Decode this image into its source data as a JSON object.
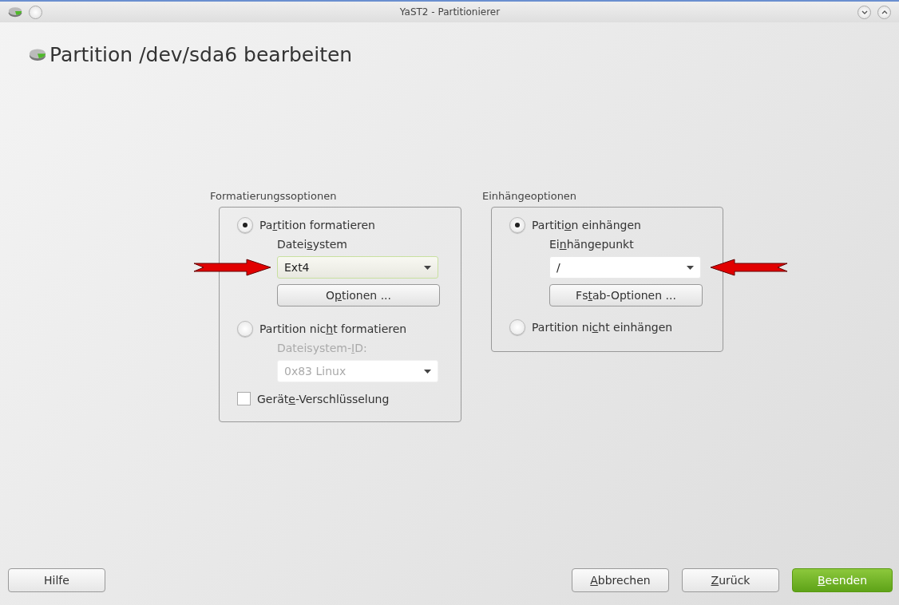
{
  "window": {
    "title": "YaST2 - Partitionierer"
  },
  "heading": "Partition /dev/sda6 bearbeiten",
  "format_group": {
    "title": "Formatierungssoptionen",
    "format_option": {
      "label_parts": [
        "Pa",
        "r",
        "tition formatieren"
      ],
      "selected": true,
      "field_label_parts": [
        "Datei",
        "s",
        "ystem"
      ],
      "value": "Ext4",
      "disabled": false,
      "highlighted": true,
      "button_parts": [
        "O",
        "p",
        "tionen ..."
      ]
    },
    "noformat_option": {
      "label_parts": [
        "Partition nic",
        "h",
        "t formatieren"
      ],
      "selected": false,
      "field_label_parts": [
        "Dateisystem-",
        "I",
        "D:"
      ],
      "value": "0x83 Linux",
      "disabled": true
    },
    "encryption": {
      "label_parts": [
        "Gerät",
        "e",
        "-Verschlüsselung"
      ],
      "checked": false
    }
  },
  "mount_group": {
    "title": "Einhängeoptionen",
    "mount_option": {
      "label_parts": [
        "Partiti",
        "o",
        "n einhängen"
      ],
      "selected": true,
      "field_label_parts": [
        "Ei",
        "n",
        "hängepunkt"
      ],
      "value": "/",
      "disabled": false,
      "highlighted": false,
      "button_parts": [
        "Fs",
        "t",
        "ab-Optionen ..."
      ]
    },
    "nomount_option": {
      "label_parts": [
        "Partition ni",
        "c",
        "ht einhängen"
      ],
      "selected": false
    }
  },
  "buttons": [
    {
      "label_parts": [
        "Hilfe"
      ],
      "kind": "normal"
    },
    {
      "label_parts": [
        "A",
        "bbrechen"
      ],
      "kind": "normal"
    },
    {
      "label_parts": [
        "Z",
        "urück"
      ],
      "kind": "normal"
    },
    {
      "label_parts": [
        "B",
        "eenden"
      ],
      "kind": "primary"
    }
  ]
}
